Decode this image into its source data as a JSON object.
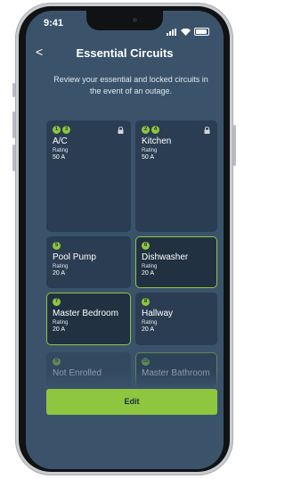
{
  "status_bar": {
    "time": "9:41"
  },
  "header": {
    "back": "<",
    "title": "Essential Circuits"
  },
  "subtitle": "Review your essential and locked circuits in the event of an outage.",
  "rating_label": "Rating",
  "cards": [
    {
      "badges": [
        "1",
        "3"
      ],
      "name": "A/C",
      "rating": "50 A",
      "locked": true,
      "selected": false
    },
    {
      "badges": [
        "2",
        "4"
      ],
      "name": "Kitchen",
      "rating": "50 A",
      "locked": true,
      "selected": false
    },
    {
      "badges": [
        "5"
      ],
      "name": "Pool Pump",
      "rating": "20 A",
      "locked": false,
      "selected": false
    },
    {
      "badges": [
        "6"
      ],
      "name": "Dishwasher",
      "rating": "20 A",
      "locked": false,
      "selected": true
    },
    {
      "badges": [
        "7"
      ],
      "name": "Master Bedroom",
      "rating": "20 A",
      "locked": false,
      "selected": true
    },
    {
      "badges": [
        "8"
      ],
      "name": "Hallway",
      "rating": "20 A",
      "locked": false,
      "selected": false
    },
    {
      "badges": [
        "9"
      ],
      "name": "Not Enrolled",
      "rating": "",
      "locked": false,
      "selected": false,
      "faded": true
    },
    {
      "badges": [
        "10"
      ],
      "name": "Master Bathroom",
      "rating": "",
      "locked": false,
      "selected": true,
      "faded": true
    }
  ],
  "edit_button": "Edit",
  "colors": {
    "accent": "#8ec63f",
    "background": "#3a536b",
    "card": "#2a3d52"
  }
}
